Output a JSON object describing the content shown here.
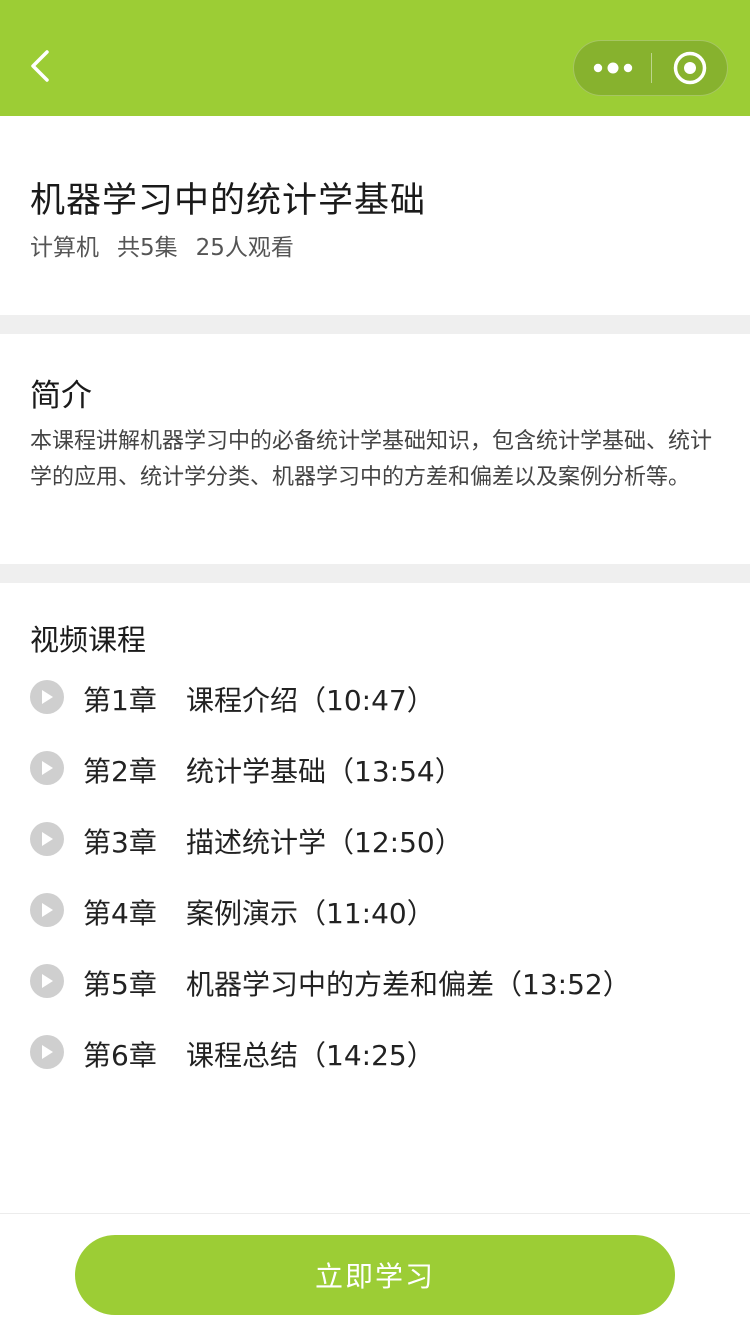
{
  "nav": {
    "back_icon": "chevron-left-icon",
    "menu_icon": "more-dots-icon",
    "close_icon": "target-circle-icon",
    "bar_color": "#9ccd35"
  },
  "course": {
    "title": "机器学习中的统计学基础",
    "category": "计算机",
    "episodes": "共5集",
    "viewers": "25人观看"
  },
  "intro": {
    "heading": "简介",
    "text": "本课程讲解机器学习中的必备统计学基础知识，包含统计学基础、统计学的应用、统计学分类、机器学习中的方差和偏差以及案例分析等。"
  },
  "videos": {
    "heading": "视频课程",
    "chapters": [
      {
        "num": "第1章",
        "title": "课程介绍（10:47）"
      },
      {
        "num": "第2章",
        "title": "统计学基础（13:54）"
      },
      {
        "num": "第3章",
        "title": "描述统计学（12:50）"
      },
      {
        "num": "第4章",
        "title": "案例演示（11:40）"
      },
      {
        "num": "第5章",
        "title": "机器学习中的方差和偏差（13:52）"
      },
      {
        "num": "第6章",
        "title": "课程总结（14:25）"
      }
    ]
  },
  "footer": {
    "button_label": "立即学习",
    "button_color": "#9ccd35"
  }
}
